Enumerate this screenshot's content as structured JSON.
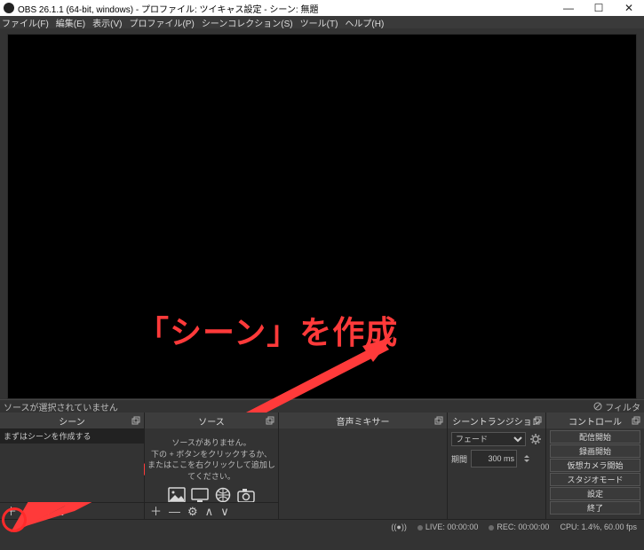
{
  "titlebar": {
    "title": "OBS 26.1.1 (64-bit, windows) - プロファイル: ツイキャス設定 - シーン: 無題"
  },
  "menu": {
    "file": "ファイル(F)",
    "edit": "編集(E)",
    "view": "表示(V)",
    "profile": "プロファイル(P)",
    "scene_collection": "シーンコレクション(S)",
    "tools": "ツール(T)",
    "help": "ヘルプ(H)"
  },
  "annotation": {
    "text": "「シーン」を作成"
  },
  "status": {
    "no_source_selected": "ソースが選択されていません",
    "filter": "フィルタ"
  },
  "panels": {
    "scenes": {
      "title": "シーン",
      "hint": "まずはシーンを作成する"
    },
    "sources": {
      "title": "ソース",
      "empty1": "ソースがありません。",
      "empty2": "下の + ボタンをクリックするか、",
      "empty3": "またはここを右クリックして追加してください。"
    },
    "mixer": {
      "title": "音声ミキサー"
    },
    "transitions": {
      "title": "シーントランジション",
      "selected": "フェード",
      "duration_label": "期間",
      "duration_value": "300 ms"
    },
    "controls": {
      "title": "コントロール",
      "buttons": [
        "配信開始",
        "録画開始",
        "仮想カメラ開始",
        "スタジオモード",
        "設定",
        "終了"
      ]
    }
  },
  "bottom": {
    "stream_icon": "((●))",
    "live": "LIVE: 00:00:00",
    "rec": "REC: 00:00:00",
    "cpu": "CPU: 1.4%, 60.00 fps"
  },
  "glyphs": {
    "plus": "＋",
    "minus": "—",
    "up": "∧",
    "down": "∨",
    "gear": "⚙"
  }
}
